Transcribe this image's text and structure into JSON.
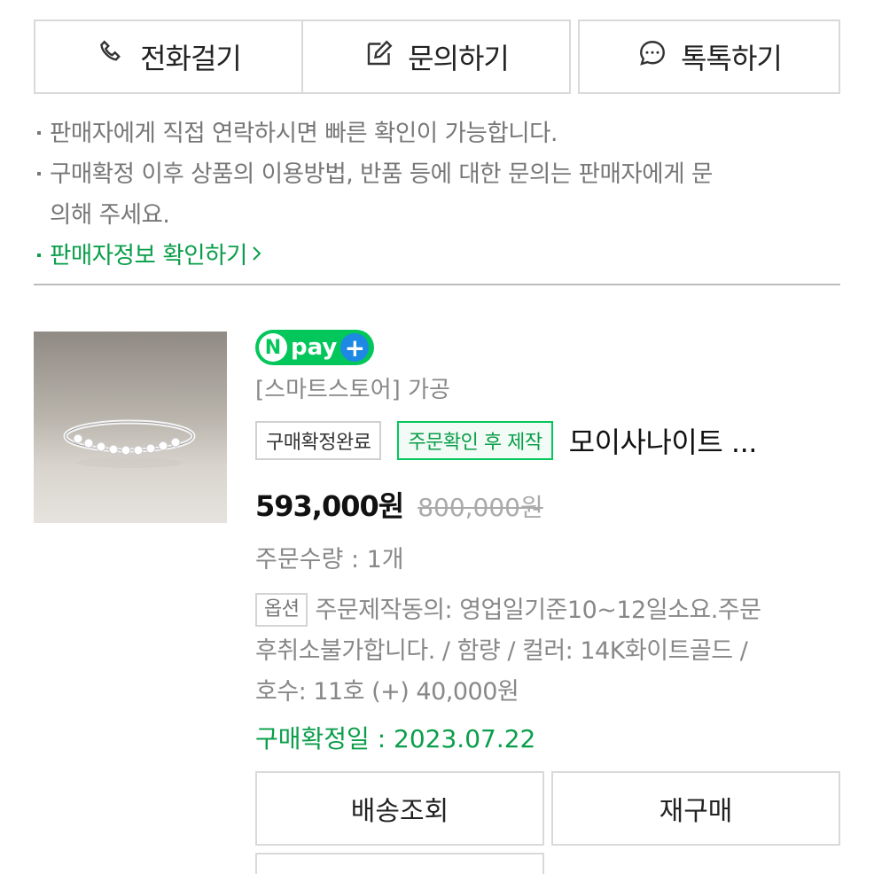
{
  "contact_buttons": {
    "call_label": "전화걸기",
    "inquiry_label": "문의하기",
    "talk_label": "톡톡하기"
  },
  "notices": {
    "line1": "판매자에게 직접 연락하시면 빠른 확인이 가능합니다.",
    "line2a": "구매확정 이후 상품의 이용방법, 반품 등에 대한 문의는 판매자에게 문",
    "line2b": "의해 주세요.",
    "seller_info_link": "판매자정보 확인하기"
  },
  "product": {
    "pay_badge": "pay",
    "store_line": "[스마트스토어] 가공",
    "status_tag": "구매확정완료",
    "made_to_order_tag": "주문확인 후 제작",
    "name": "모이사나이트 ...",
    "price": "593,000원",
    "original_price": "800,000원",
    "quantity": "주문수량 : 1개",
    "option_tag": "옵션",
    "option_text_1": "주문제작동의: 영업일기준10~12일소요.주문",
    "option_text_2": "후취소불가합니다. / 함량 / 컬러: 14K화이트골드 /",
    "option_text_3": "호수: 11호 (+) 40,000원",
    "confirm_date": "구매확정일 : 2023.07.22"
  },
  "actions": {
    "delivery_label": "배송조회",
    "rebuy_label": "재구매"
  },
  "colors": {
    "accent_green": "#0a9e4a",
    "npay_green": "#03c75a",
    "border": "#d9d9d9"
  },
  "icons": [
    "phone-icon",
    "edit-icon",
    "chat-bubble-icon",
    "chevron-right-icon",
    "plus-icon"
  ]
}
